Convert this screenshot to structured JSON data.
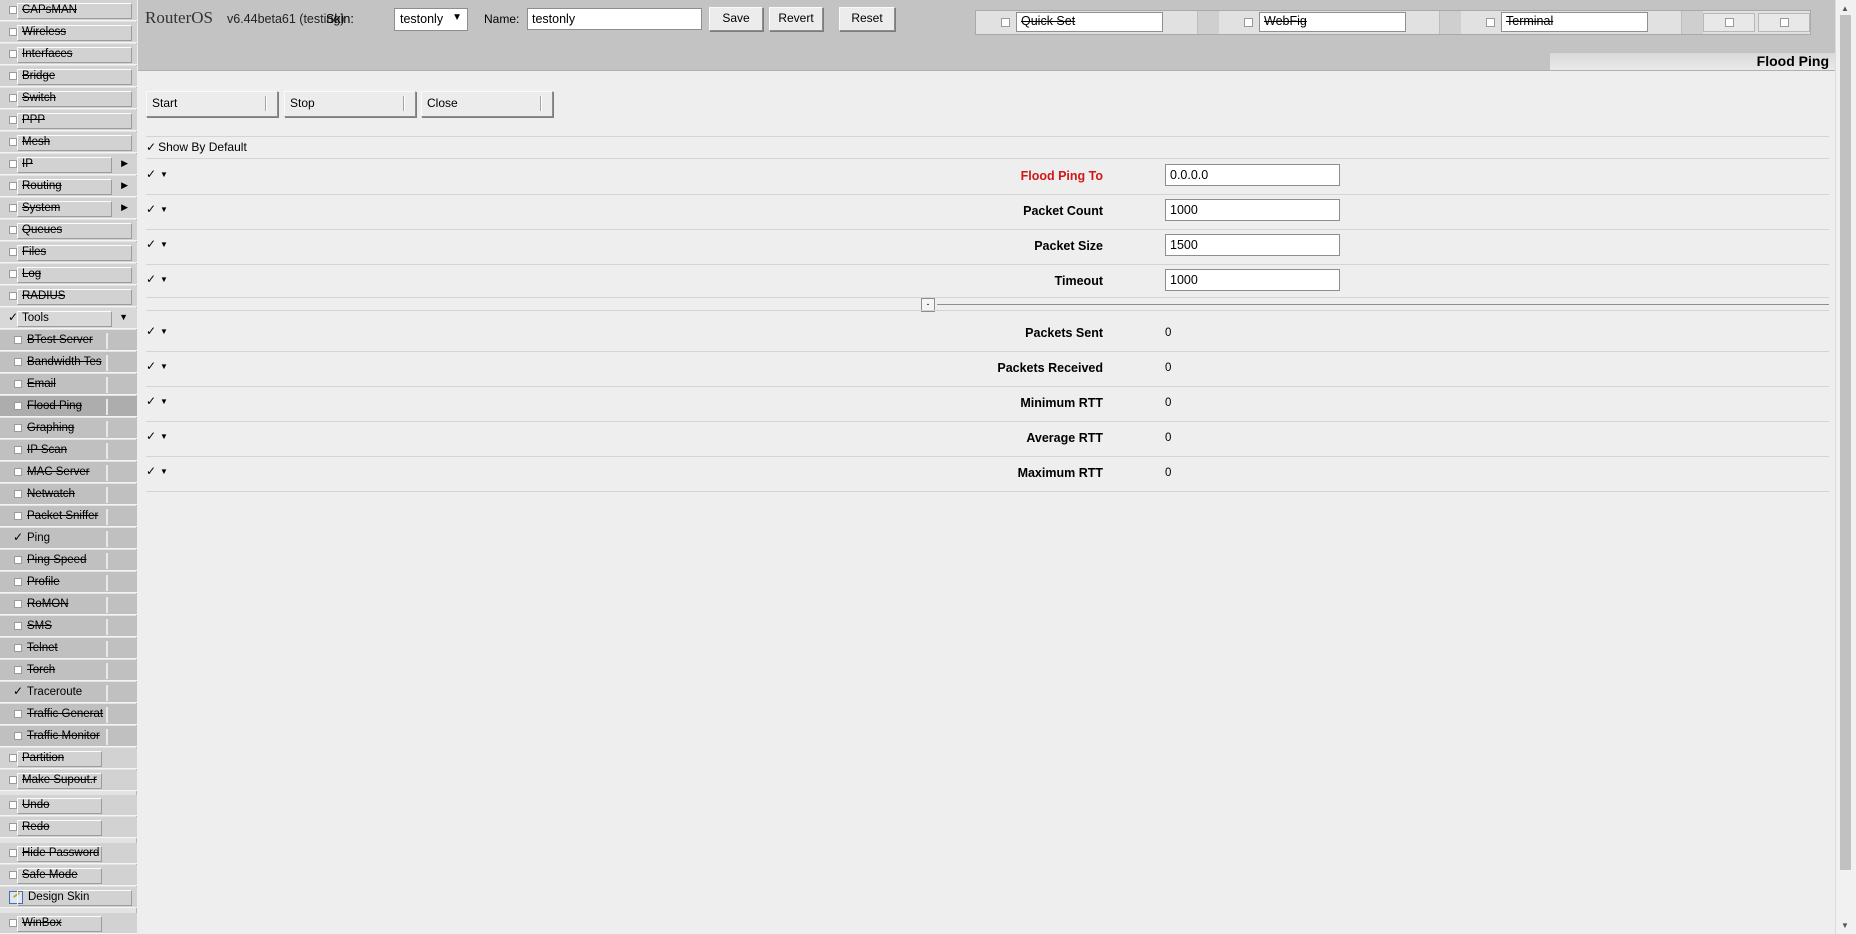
{
  "sidebar": {
    "items": [
      {
        "label": "CAPsMAN"
      },
      {
        "label": "Wireless"
      },
      {
        "label": "Interfaces"
      },
      {
        "label": "Bridge"
      },
      {
        "label": "Switch"
      },
      {
        "label": "PPP"
      },
      {
        "label": "Mesh"
      },
      {
        "label": "IP",
        "arrow": "▶"
      },
      {
        "label": "Routing",
        "arrow": "▶"
      },
      {
        "label": "System",
        "arrow": "▶"
      },
      {
        "label": "Queues"
      },
      {
        "label": "Files"
      },
      {
        "label": "Log"
      },
      {
        "label": "RADIUS"
      },
      {
        "label": "Tools",
        "arrow": "▼"
      }
    ],
    "tools_items": [
      {
        "label": "BTest Server"
      },
      {
        "label": "Bandwidth Tes"
      },
      {
        "label": "Email"
      },
      {
        "label": "Flood Ping"
      },
      {
        "label": "Graphing"
      },
      {
        "label": "IP Scan"
      },
      {
        "label": "MAC Server"
      },
      {
        "label": "Netwatch"
      },
      {
        "label": "Packet Sniffer"
      },
      {
        "label": "Ping"
      },
      {
        "label": "Ping Speed"
      },
      {
        "label": "Profile"
      },
      {
        "label": "RoMON"
      },
      {
        "label": "SMS"
      },
      {
        "label": "Telnet"
      },
      {
        "label": "Torch"
      },
      {
        "label": "Traceroute"
      },
      {
        "label": "Traffic Generat"
      },
      {
        "label": "Traffic Monitor"
      }
    ],
    "bottom_items": [
      {
        "label": "Partition"
      },
      {
        "label": "Make Supout.r"
      },
      {
        "label": "Undo"
      },
      {
        "label": "Redo"
      },
      {
        "label": "Hide Password"
      },
      {
        "label": "Safe Mode"
      },
      {
        "label": "Design Skin"
      },
      {
        "label": "WinBox"
      }
    ]
  },
  "header": {
    "brand": "RouterOS",
    "version": "v6.44beta61 (testing)",
    "skin_label": "Skin:",
    "skin_value": "testonly",
    "name_label": "Name:",
    "name_value": "testonly",
    "save_label": "Save",
    "revert_label": "Revert",
    "reset_label": "Reset",
    "quick_tabs": [
      "Quick Set",
      "WebFig",
      "Terminal"
    ],
    "page_title": "Flood Ping"
  },
  "main": {
    "actions": {
      "start": "Start",
      "stop": "Stop",
      "close": "Close"
    },
    "show_by_default": "Show By Default",
    "fields": [
      {
        "label": "Flood Ping To",
        "value": "0.0.0.0"
      },
      {
        "label": "Packet Count",
        "value": "1000"
      },
      {
        "label": "Packet Size",
        "value": "1500"
      },
      {
        "label": "Timeout",
        "value": "1000"
      }
    ],
    "collapse_label": "-",
    "results": [
      {
        "label": "Packets Sent",
        "value": "0"
      },
      {
        "label": "Packets Received",
        "value": "0"
      },
      {
        "label": "Minimum RTT",
        "value": "0"
      },
      {
        "label": "Average RTT",
        "value": "0"
      },
      {
        "label": "Maximum RTT",
        "value": "0"
      }
    ]
  },
  "colors": {
    "required_label": "#d01818",
    "header_bg": "#c3c3c3",
    "sidebar_bg": "#d2d2d2"
  }
}
